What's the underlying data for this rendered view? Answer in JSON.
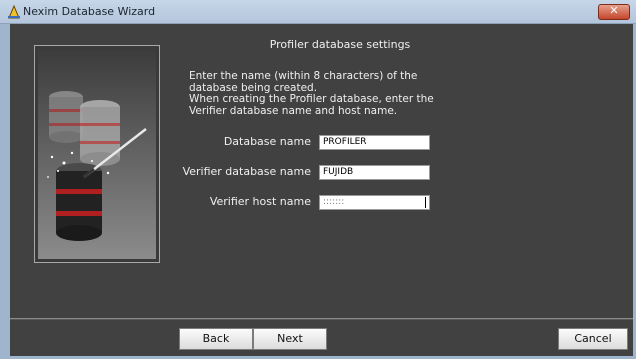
{
  "window": {
    "title": "Nexim Database Wizard",
    "close_label": "✕"
  },
  "page": {
    "heading": "Profiler database settings",
    "description": "Enter the name (within 8 characters) of the\ndatabase being created.\nWhen creating the Profiler database, enter the\nVerifier database name and host name."
  },
  "fields": {
    "database_name": {
      "label": "Database name",
      "value": "PROFILER"
    },
    "verifier_database_name": {
      "label": "Verifier database name",
      "value": "FUJIDB"
    },
    "verifier_host_name": {
      "label": "Verifier host name",
      "value": ":::::::"
    }
  },
  "buttons": {
    "back": "Back",
    "next": "Next",
    "cancel": "Cancel"
  },
  "icons": {
    "app": "wizard-hat-icon",
    "close": "close-icon",
    "illustration": "database-wizard-illustration"
  },
  "colors": {
    "dialog_background": "#414141",
    "titlebar": "#c7d6e8",
    "close_button": "#c4462d"
  }
}
